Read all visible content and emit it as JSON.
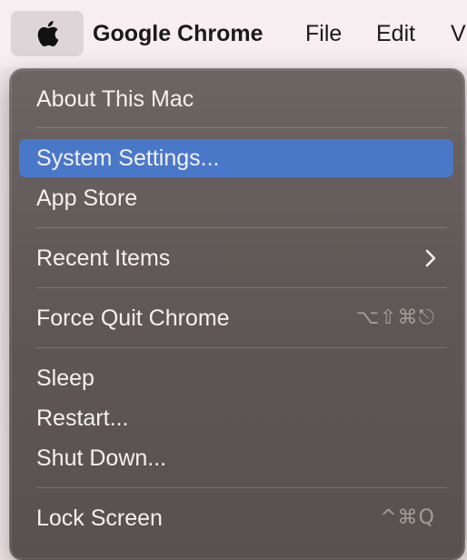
{
  "menubar": {
    "apple_icon": "apple-logo-icon",
    "app_name": "Google Chrome",
    "file_label": "File",
    "edit_label": "Edit",
    "view_label_partial": "V"
  },
  "apple_menu": {
    "about": "About This Mac",
    "system_settings": "System Settings...",
    "app_store": "App Store",
    "recent_items": "Recent Items",
    "recent_items_icon": "chevron-right-icon",
    "force_quit": "Force Quit Chrome",
    "force_quit_shortcut": "⌥⇧⌘⎋",
    "sleep": "Sleep",
    "restart": "Restart...",
    "shut_down": "Shut Down...",
    "lock_screen": "Lock Screen",
    "lock_screen_shortcut": "^⌘Q",
    "selected_item": "System Settings...",
    "highlight_color": "#4a78c9"
  }
}
